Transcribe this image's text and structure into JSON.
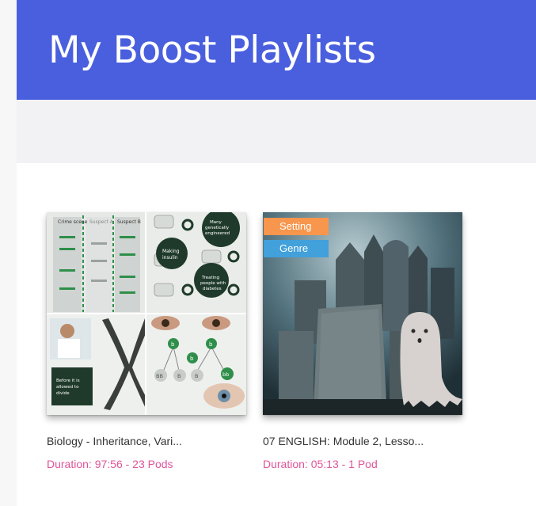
{
  "header": {
    "title": "My Boost Playlists"
  },
  "playlists": [
    {
      "title": "Biology - Inheritance, Vari...",
      "meta": "Duration: 97:56 - 23 Pods",
      "thumbnail_labels": [
        "Crime scene",
        "Suspect A",
        "Suspect B",
        "Making insulin",
        "Many genetically engineered bacteria",
        "Treating people with diabetes",
        "Before it is allowed to divide",
        "b",
        "b",
        "b",
        "BB",
        "B",
        "B",
        "bb"
      ]
    },
    {
      "title": "07 ENGLISH: Module 2, Lesso...",
      "meta": "Duration: 05:13 - 1 Pod",
      "tags": [
        "Setting",
        "Genre"
      ]
    }
  ],
  "colors": {
    "header": "#4a5fde",
    "meta": "#e0559a",
    "tag_setting": "#f7964c",
    "tag_genre": "#42a0db"
  }
}
